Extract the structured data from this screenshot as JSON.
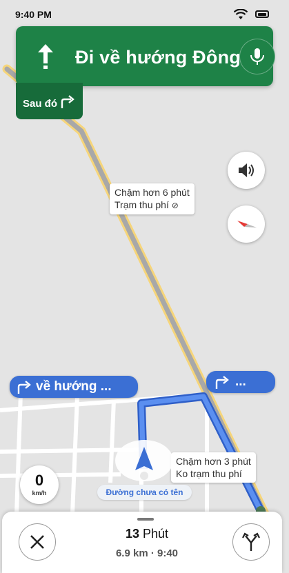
{
  "status_bar": {
    "time": "9:40 PM"
  },
  "instruction": {
    "direction": "Đi về hướng Đông",
    "then_label": "Sau đó"
  },
  "callouts": {
    "slower_6": {
      "line1": "Chậm hơn 6 phút",
      "line2": "Trạm thu phí"
    },
    "slower_3": {
      "line1": "Chậm hơn  3  phút",
      "line2": "Ko trạm thu phí"
    }
  },
  "route_pills": {
    "left": "về hướng ...",
    "right": "..."
  },
  "speedometer": {
    "value": "0",
    "unit": "km/h"
  },
  "current_road": "Đường chưa có tên",
  "trip": {
    "minutes": "13",
    "minutes_unit": "Phút",
    "summary": "6.9 km · 9:40"
  },
  "colors": {
    "nav_green": "#1e8247",
    "route_blue": "#4a7ee8",
    "alt_route_gray": "#9e9e9e",
    "toll_yellow": "#f6d57a"
  },
  "icons": [
    "straight-arrow-icon",
    "microphone-icon",
    "turn-right-icon",
    "speaker-icon",
    "compass-icon",
    "navigation-arrow-icon",
    "close-icon",
    "alternate-routes-icon",
    "wifi-icon",
    "battery-icon"
  ]
}
